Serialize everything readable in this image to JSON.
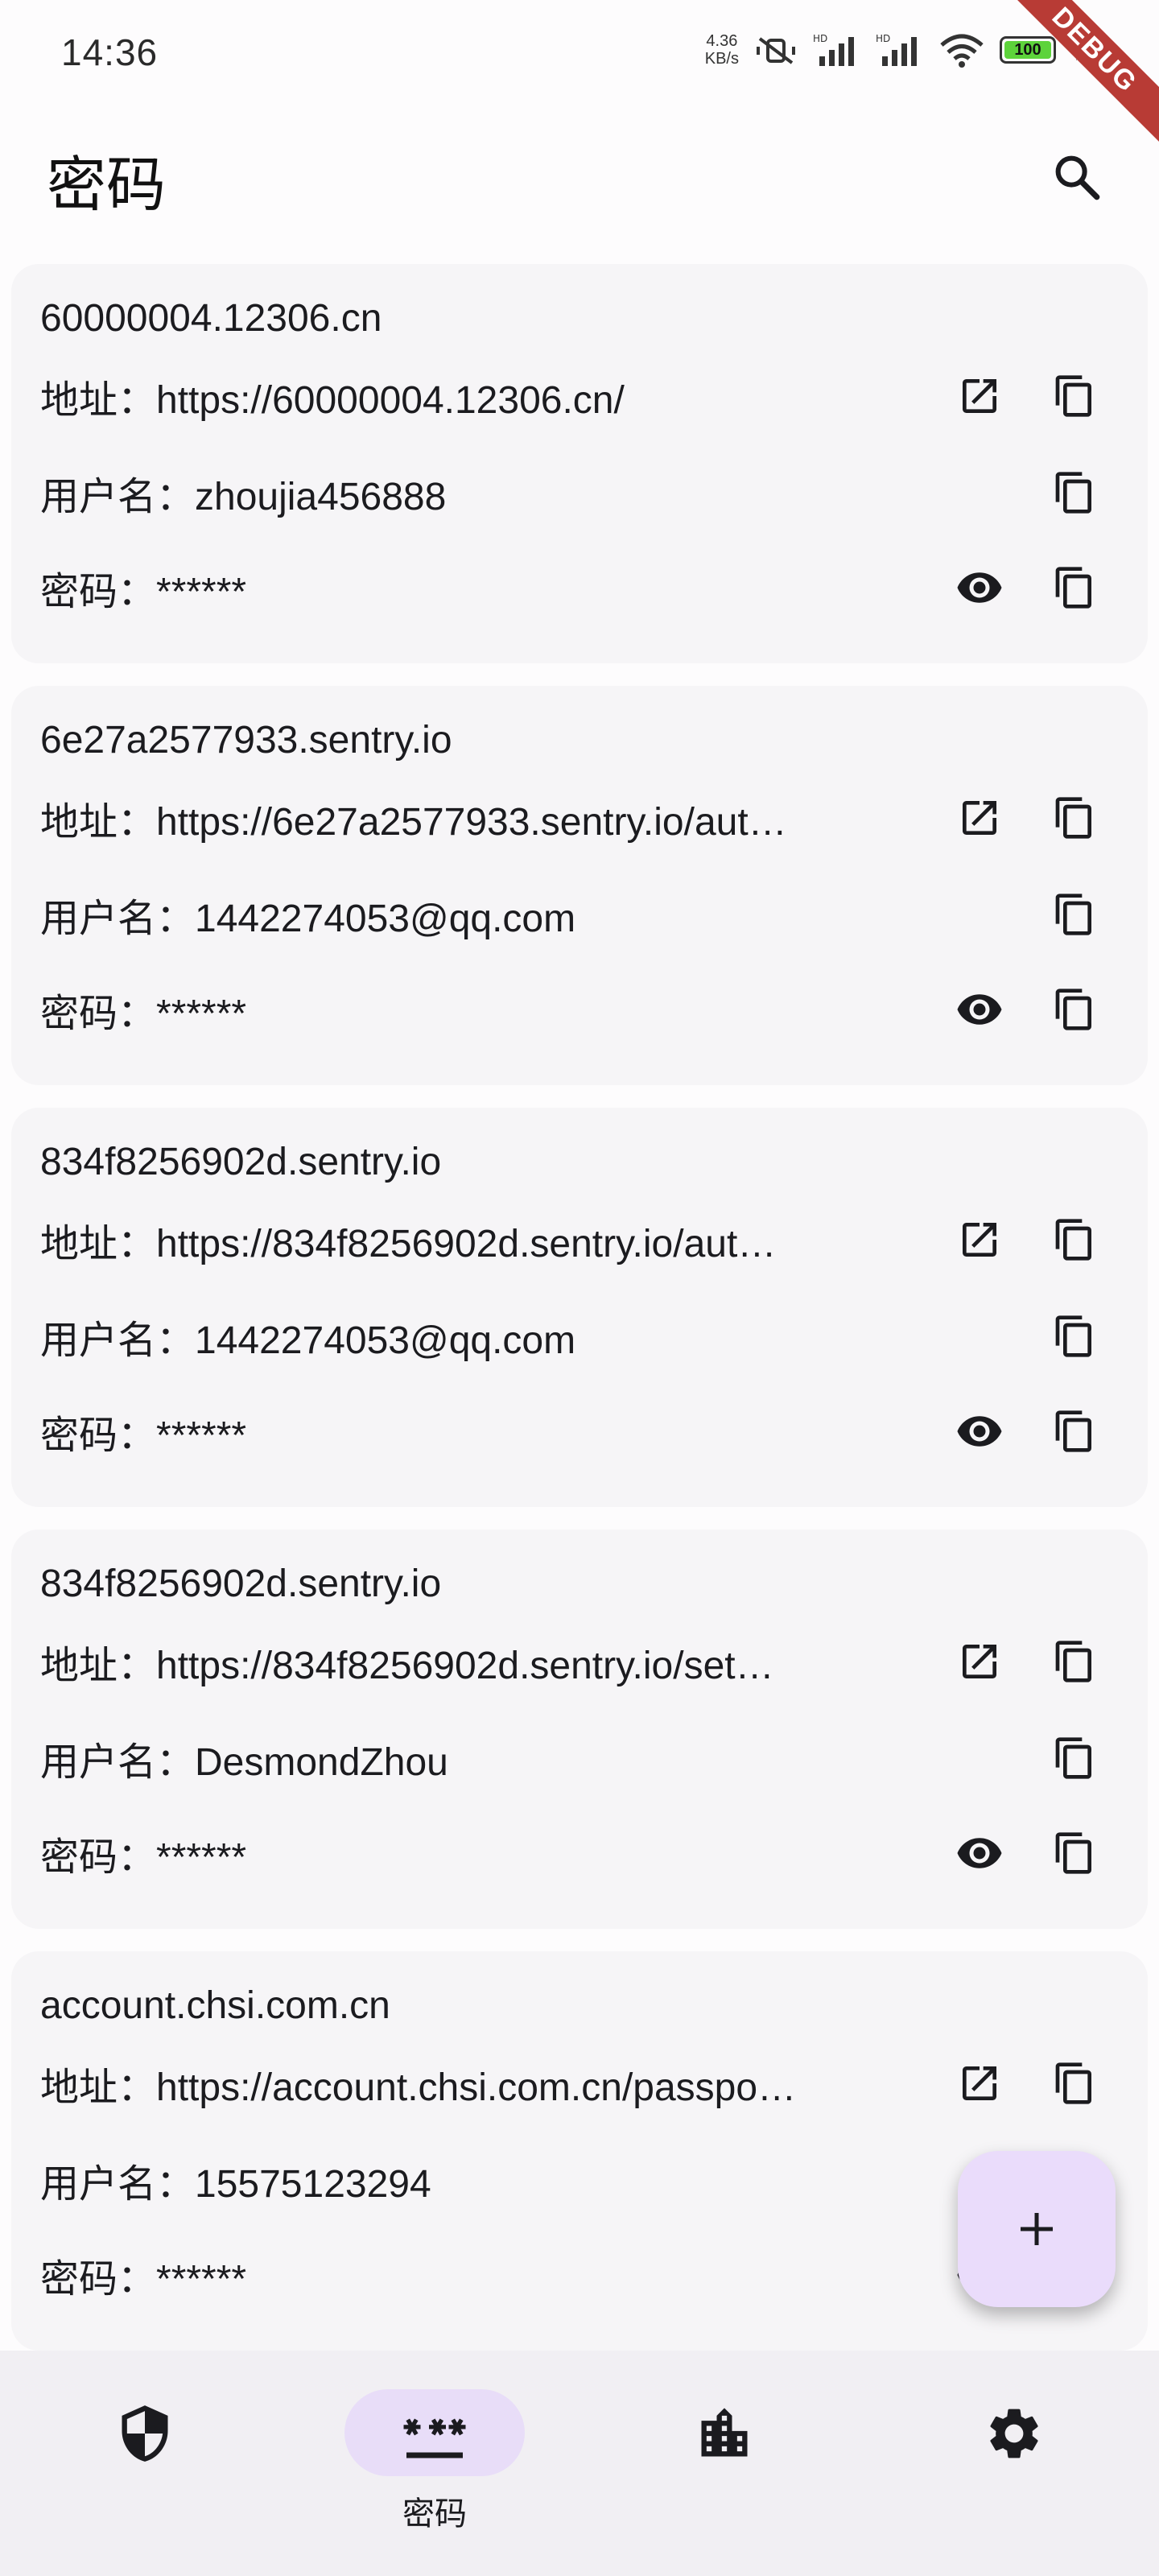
{
  "status_bar": {
    "time": "14:36",
    "net_speed_value": "4.36",
    "net_speed_unit": "KB/s",
    "battery": "100",
    "debug_banner": "DEBUG"
  },
  "app_bar": {
    "title": "密码",
    "search_icon": "search-icon"
  },
  "labels": {
    "url": "地址：",
    "username": "用户名：",
    "password": "密码："
  },
  "entries": [
    {
      "title": "60000004.12306.cn",
      "url": "https://60000004.12306.cn/",
      "username": "zhoujia456888",
      "password": "******"
    },
    {
      "title": "6e27a2577933.sentry.io",
      "url": "https://6e27a2577933.sentry.io/aut…",
      "username": "1442274053@qq.com",
      "password": "******"
    },
    {
      "title": "834f8256902d.sentry.io",
      "url": "https://834f8256902d.sentry.io/aut…",
      "username": "1442274053@qq.com",
      "password": "******"
    },
    {
      "title": "834f8256902d.sentry.io",
      "url": "https://834f8256902d.sentry.io/set…",
      "username": "DesmondZhou",
      "password": "******"
    },
    {
      "title": "account.chsi.com.cn",
      "url": "https://account.chsi.com.cn/passpo…",
      "username": "15575123294",
      "password": "******"
    }
  ],
  "fab": {
    "icon": "plus-icon"
  },
  "bottom_nav": {
    "items": [
      {
        "icon": "shield-icon",
        "label": ""
      },
      {
        "icon": "password-icon",
        "label": "密码"
      },
      {
        "icon": "building-icon",
        "label": ""
      },
      {
        "icon": "gear-icon",
        "label": ""
      }
    ],
    "active_index": 1
  },
  "colors": {
    "background": "#fdfcfd",
    "card": "#f6f5f7",
    "accent_container": "#eadcfb",
    "nav_background": "#f1eff3",
    "debug_ribbon": "#b83b35"
  }
}
